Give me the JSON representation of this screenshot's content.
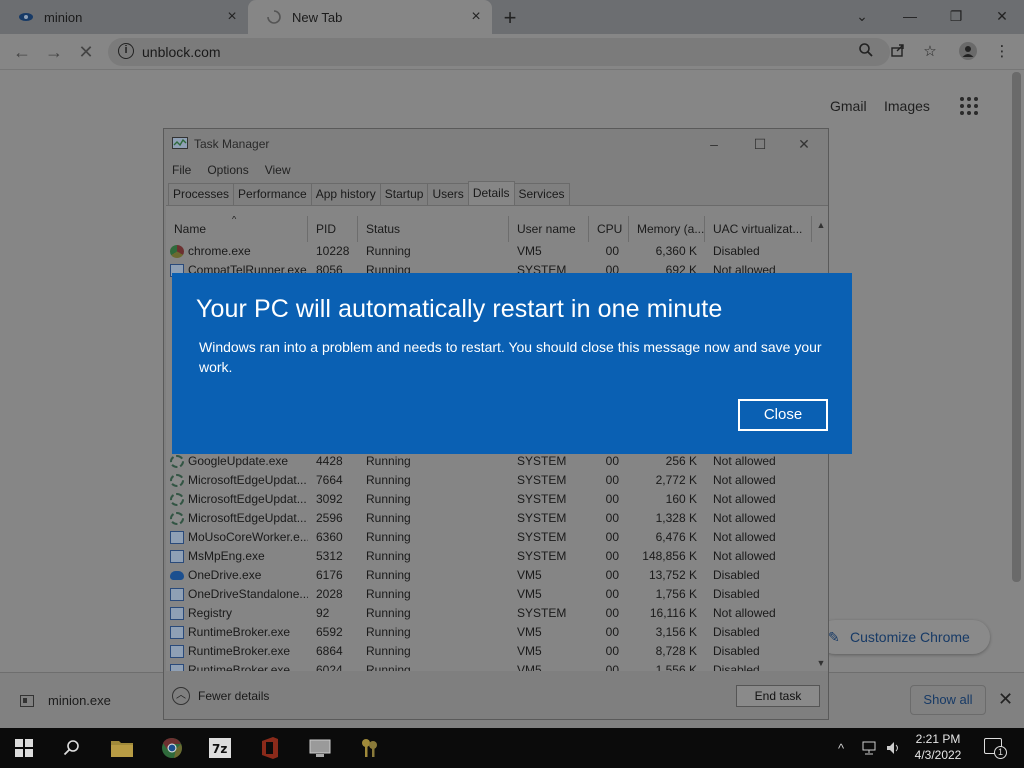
{
  "browser": {
    "tabs": [
      {
        "label": "minion"
      },
      {
        "label": "New Tab"
      }
    ],
    "url": "unblock.com",
    "ntp": {
      "gmail": "Gmail",
      "images": "Images",
      "customize": "Customize Chrome"
    },
    "download": {
      "file": "minion.exe",
      "show_all": "Show all"
    }
  },
  "taskmgr": {
    "title": "Task Manager",
    "menu": [
      "File",
      "Options",
      "View"
    ],
    "tabs": [
      "Processes",
      "Performance",
      "App history",
      "Startup",
      "Users",
      "Details",
      "Services"
    ],
    "active_tab": "Details",
    "columns": [
      "Name",
      "PID",
      "Status",
      "User name",
      "CPU",
      "Memory (a...",
      "UAC virtualizat..."
    ],
    "rows_top": [
      {
        "name": "chrome.exe",
        "pid": "10228",
        "status": "Running",
        "user": "VM5",
        "cpu": "00",
        "mem": "6,360 K",
        "uac": "Disabled",
        "icon": "chrome"
      },
      {
        "name": "CompatTelRunner.exe",
        "pid": "8056",
        "status": "Running",
        "user": "SYSTEM",
        "cpu": "00",
        "mem": "692 K",
        "uac": "Not allowed",
        "icon": "generic"
      }
    ],
    "rows_bottom": [
      {
        "name": "GoogleUpdate.exe",
        "pid": "4428",
        "status": "Running",
        "user": "SYSTEM",
        "cpu": "00",
        "mem": "256 K",
        "uac": "Not allowed",
        "icon": "gear"
      },
      {
        "name": "MicrosoftEdgeUpdat...",
        "pid": "7664",
        "status": "Running",
        "user": "SYSTEM",
        "cpu": "00",
        "mem": "2,772 K",
        "uac": "Not allowed",
        "icon": "gear"
      },
      {
        "name": "MicrosoftEdgeUpdat...",
        "pid": "3092",
        "status": "Running",
        "user": "SYSTEM",
        "cpu": "00",
        "mem": "160 K",
        "uac": "Not allowed",
        "icon": "gear"
      },
      {
        "name": "MicrosoftEdgeUpdat...",
        "pid": "2596",
        "status": "Running",
        "user": "SYSTEM",
        "cpu": "00",
        "mem": "1,328 K",
        "uac": "Not allowed",
        "icon": "gear"
      },
      {
        "name": "MoUsoCoreWorker.e...",
        "pid": "6360",
        "status": "Running",
        "user": "SYSTEM",
        "cpu": "00",
        "mem": "6,476 K",
        "uac": "Not allowed",
        "icon": "generic"
      },
      {
        "name": "MsMpEng.exe",
        "pid": "5312",
        "status": "Running",
        "user": "SYSTEM",
        "cpu": "00",
        "mem": "148,856 K",
        "uac": "Not allowed",
        "icon": "generic"
      },
      {
        "name": "OneDrive.exe",
        "pid": "6176",
        "status": "Running",
        "user": "VM5",
        "cpu": "00",
        "mem": "13,752 K",
        "uac": "Disabled",
        "icon": "cloud"
      },
      {
        "name": "OneDriveStandalone...",
        "pid": "2028",
        "status": "Running",
        "user": "VM5",
        "cpu": "00",
        "mem": "1,756 K",
        "uac": "Disabled",
        "icon": "generic"
      },
      {
        "name": "Registry",
        "pid": "92",
        "status": "Running",
        "user": "SYSTEM",
        "cpu": "00",
        "mem": "16,116 K",
        "uac": "Not allowed",
        "icon": "generic"
      },
      {
        "name": "RuntimeBroker.exe",
        "pid": "6592",
        "status": "Running",
        "user": "VM5",
        "cpu": "00",
        "mem": "3,156 K",
        "uac": "Disabled",
        "icon": "generic"
      },
      {
        "name": "RuntimeBroker.exe",
        "pid": "6864",
        "status": "Running",
        "user": "VM5",
        "cpu": "00",
        "mem": "8,728 K",
        "uac": "Disabled",
        "icon": "generic"
      },
      {
        "name": "RuntimeBroker.exe",
        "pid": "6024",
        "status": "Running",
        "user": "VM5",
        "cpu": "00",
        "mem": "1,556 K",
        "uac": "Disabled",
        "icon": "generic"
      }
    ],
    "fewer_details": "Fewer details",
    "end_task": "End task"
  },
  "alert": {
    "heading": "Your PC will automatically restart in one minute",
    "message": "Windows ran into a problem and needs to restart. You should close this message now and save your work.",
    "close": "Close"
  },
  "taskbar": {
    "time": "2:21 PM",
    "date": "4/3/2022",
    "apps": [
      "start-icon",
      "search-icon",
      "file-explorer-icon",
      "chrome-icon",
      "7zip-icon",
      "office-icon",
      "remote-desktop-icon",
      "keys-icon"
    ],
    "notification_count": "1"
  },
  "colors": {
    "alert_bg": "#0a60b3",
    "taskbar_bg": "#0b0b0b"
  }
}
